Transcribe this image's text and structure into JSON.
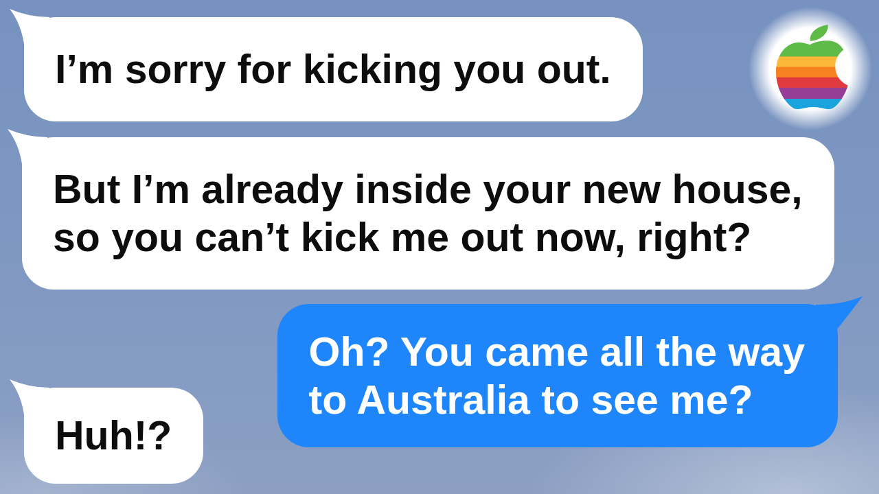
{
  "messages": [
    {
      "kind": "received",
      "text": "I’m sorry for kicking you out."
    },
    {
      "kind": "received",
      "text": "But I’m already inside your new house,\nso you can’t kick me out now, right?"
    },
    {
      "kind": "sent",
      "text": "Oh? You came all the way\nto Australia to see me?"
    },
    {
      "kind": "received",
      "text": "Huh!?"
    }
  ]
}
